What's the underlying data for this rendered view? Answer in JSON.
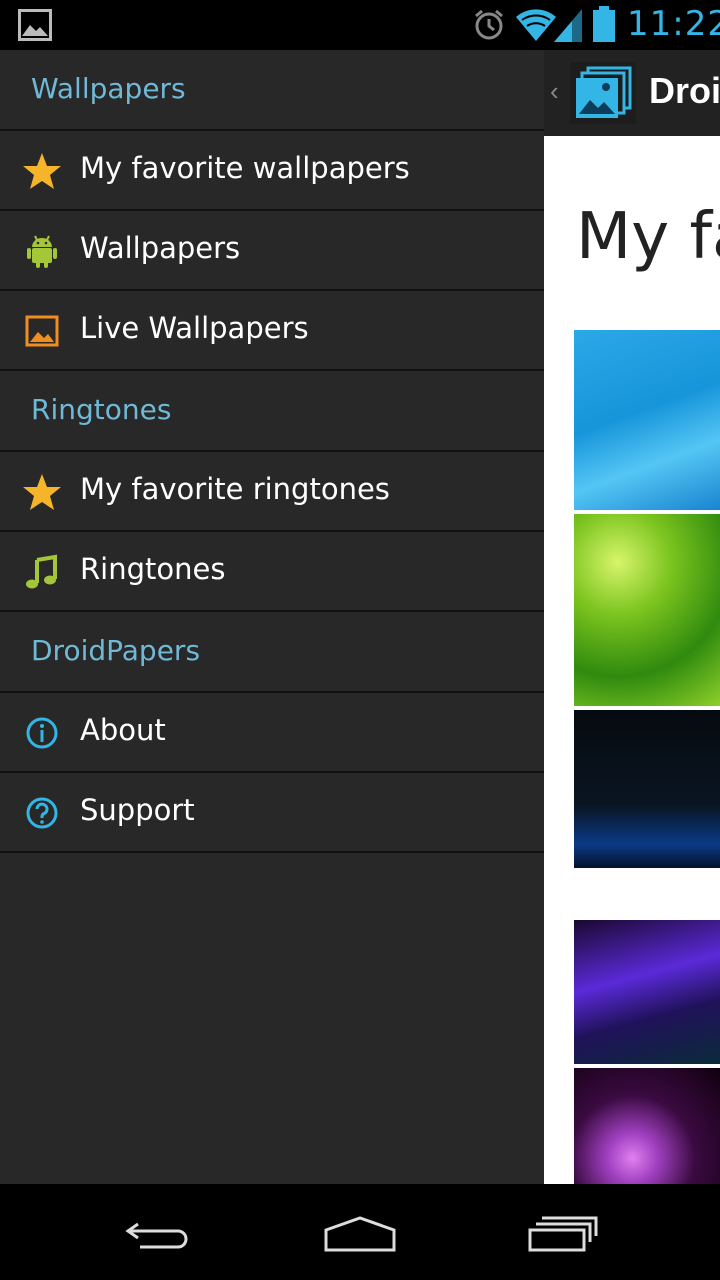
{
  "status_bar": {
    "time": "11:22",
    "icons": [
      "image-notification-icon",
      "alarm-icon",
      "wifi-icon",
      "signal-icon",
      "battery-icon"
    ]
  },
  "action_bar": {
    "title": "Droi",
    "up_caret": "‹"
  },
  "main": {
    "page_title": "My fa"
  },
  "drawer": {
    "sections": [
      {
        "label": "Wallpapers",
        "items": [
          {
            "label": "My favorite wallpapers",
            "icon": "star-icon"
          },
          {
            "label": "Wallpapers",
            "icon": "android-icon"
          },
          {
            "label": "Live Wallpapers",
            "icon": "image-icon"
          }
        ]
      },
      {
        "label": "Ringtones",
        "items": [
          {
            "label": "My favorite ringtones",
            "icon": "star-icon"
          },
          {
            "label": "Ringtones",
            "icon": "music-note-icon"
          }
        ]
      },
      {
        "label": "DroidPapers",
        "items": [
          {
            "label": "About",
            "icon": "info-icon"
          },
          {
            "label": "Support",
            "icon": "help-icon"
          }
        ]
      }
    ]
  },
  "nav_bar": {
    "buttons": [
      "back-icon",
      "home-icon",
      "recent-apps-icon"
    ]
  },
  "colors": {
    "accent": "#33b5e5",
    "section_label": "#6fb9d7",
    "drawer_bg": "#282828",
    "star": "#f6b42b",
    "android_green": "#a4c639",
    "live_orange": "#f28d1f"
  }
}
